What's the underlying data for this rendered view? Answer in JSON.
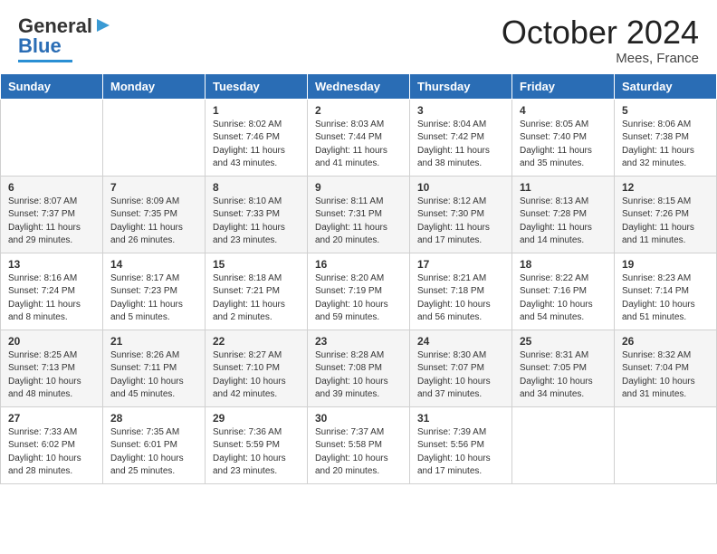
{
  "header": {
    "logo_general": "General",
    "logo_blue": "Blue",
    "month_title": "October 2024",
    "location": "Mees, France"
  },
  "days_of_week": [
    "Sunday",
    "Monday",
    "Tuesday",
    "Wednesday",
    "Thursday",
    "Friday",
    "Saturday"
  ],
  "weeks": [
    [
      {
        "day": "",
        "info": ""
      },
      {
        "day": "",
        "info": ""
      },
      {
        "day": "1",
        "info": "Sunrise: 8:02 AM\nSunset: 7:46 PM\nDaylight: 11 hours and 43 minutes."
      },
      {
        "day": "2",
        "info": "Sunrise: 8:03 AM\nSunset: 7:44 PM\nDaylight: 11 hours and 41 minutes."
      },
      {
        "day": "3",
        "info": "Sunrise: 8:04 AM\nSunset: 7:42 PM\nDaylight: 11 hours and 38 minutes."
      },
      {
        "day": "4",
        "info": "Sunrise: 8:05 AM\nSunset: 7:40 PM\nDaylight: 11 hours and 35 minutes."
      },
      {
        "day": "5",
        "info": "Sunrise: 8:06 AM\nSunset: 7:38 PM\nDaylight: 11 hours and 32 minutes."
      }
    ],
    [
      {
        "day": "6",
        "info": "Sunrise: 8:07 AM\nSunset: 7:37 PM\nDaylight: 11 hours and 29 minutes."
      },
      {
        "day": "7",
        "info": "Sunrise: 8:09 AM\nSunset: 7:35 PM\nDaylight: 11 hours and 26 minutes."
      },
      {
        "day": "8",
        "info": "Sunrise: 8:10 AM\nSunset: 7:33 PM\nDaylight: 11 hours and 23 minutes."
      },
      {
        "day": "9",
        "info": "Sunrise: 8:11 AM\nSunset: 7:31 PM\nDaylight: 11 hours and 20 minutes."
      },
      {
        "day": "10",
        "info": "Sunrise: 8:12 AM\nSunset: 7:30 PM\nDaylight: 11 hours and 17 minutes."
      },
      {
        "day": "11",
        "info": "Sunrise: 8:13 AM\nSunset: 7:28 PM\nDaylight: 11 hours and 14 minutes."
      },
      {
        "day": "12",
        "info": "Sunrise: 8:15 AM\nSunset: 7:26 PM\nDaylight: 11 hours and 11 minutes."
      }
    ],
    [
      {
        "day": "13",
        "info": "Sunrise: 8:16 AM\nSunset: 7:24 PM\nDaylight: 11 hours and 8 minutes."
      },
      {
        "day": "14",
        "info": "Sunrise: 8:17 AM\nSunset: 7:23 PM\nDaylight: 11 hours and 5 minutes."
      },
      {
        "day": "15",
        "info": "Sunrise: 8:18 AM\nSunset: 7:21 PM\nDaylight: 11 hours and 2 minutes."
      },
      {
        "day": "16",
        "info": "Sunrise: 8:20 AM\nSunset: 7:19 PM\nDaylight: 10 hours and 59 minutes."
      },
      {
        "day": "17",
        "info": "Sunrise: 8:21 AM\nSunset: 7:18 PM\nDaylight: 10 hours and 56 minutes."
      },
      {
        "day": "18",
        "info": "Sunrise: 8:22 AM\nSunset: 7:16 PM\nDaylight: 10 hours and 54 minutes."
      },
      {
        "day": "19",
        "info": "Sunrise: 8:23 AM\nSunset: 7:14 PM\nDaylight: 10 hours and 51 minutes."
      }
    ],
    [
      {
        "day": "20",
        "info": "Sunrise: 8:25 AM\nSunset: 7:13 PM\nDaylight: 10 hours and 48 minutes."
      },
      {
        "day": "21",
        "info": "Sunrise: 8:26 AM\nSunset: 7:11 PM\nDaylight: 10 hours and 45 minutes."
      },
      {
        "day": "22",
        "info": "Sunrise: 8:27 AM\nSunset: 7:10 PM\nDaylight: 10 hours and 42 minutes."
      },
      {
        "day": "23",
        "info": "Sunrise: 8:28 AM\nSunset: 7:08 PM\nDaylight: 10 hours and 39 minutes."
      },
      {
        "day": "24",
        "info": "Sunrise: 8:30 AM\nSunset: 7:07 PM\nDaylight: 10 hours and 37 minutes."
      },
      {
        "day": "25",
        "info": "Sunrise: 8:31 AM\nSunset: 7:05 PM\nDaylight: 10 hours and 34 minutes."
      },
      {
        "day": "26",
        "info": "Sunrise: 8:32 AM\nSunset: 7:04 PM\nDaylight: 10 hours and 31 minutes."
      }
    ],
    [
      {
        "day": "27",
        "info": "Sunrise: 7:33 AM\nSunset: 6:02 PM\nDaylight: 10 hours and 28 minutes."
      },
      {
        "day": "28",
        "info": "Sunrise: 7:35 AM\nSunset: 6:01 PM\nDaylight: 10 hours and 25 minutes."
      },
      {
        "day": "29",
        "info": "Sunrise: 7:36 AM\nSunset: 5:59 PM\nDaylight: 10 hours and 23 minutes."
      },
      {
        "day": "30",
        "info": "Sunrise: 7:37 AM\nSunset: 5:58 PM\nDaylight: 10 hours and 20 minutes."
      },
      {
        "day": "31",
        "info": "Sunrise: 7:39 AM\nSunset: 5:56 PM\nDaylight: 10 hours and 17 minutes."
      },
      {
        "day": "",
        "info": ""
      },
      {
        "day": "",
        "info": ""
      }
    ]
  ]
}
